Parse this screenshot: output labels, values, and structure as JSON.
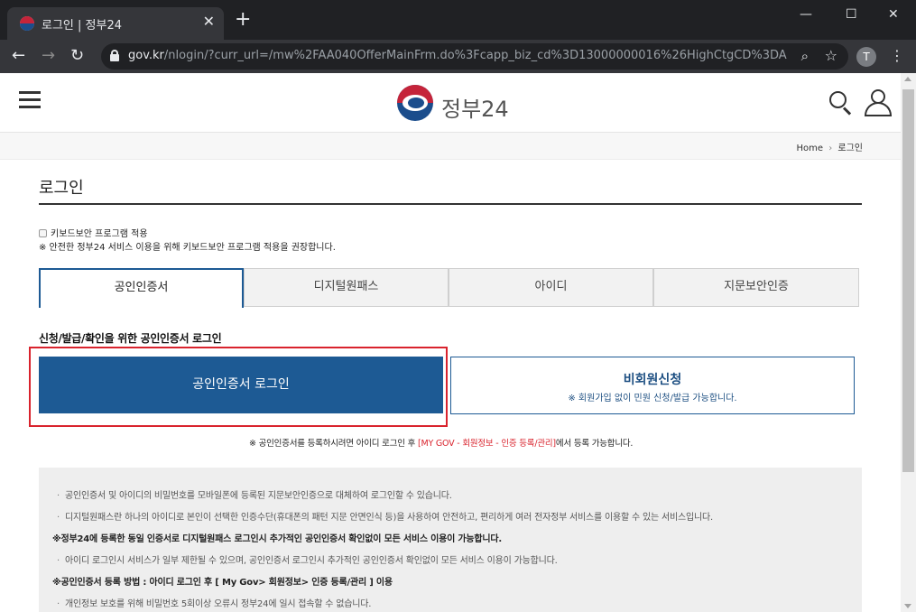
{
  "browser": {
    "tab_title": "로그인 | 정부24",
    "tab_close": "✕",
    "new_tab": "+",
    "url_host": "gov.kr",
    "url_path": "/nlogin/?curr_url=/mw%2FAA040OfferMainFrm.do%3Fcapp_biz_cd%3D13000000016%26HighCtgCD%3DA...",
    "profile_initial": "T",
    "window_controls": {
      "minimize": "—",
      "maximize": "☐",
      "close": "✕"
    },
    "nav": {
      "back": "←",
      "forward": "→",
      "reload": "↻"
    }
  },
  "header": {
    "logo_text": "정부24"
  },
  "breadcrumb": {
    "home": "Home",
    "separator": "›",
    "current": "로그인"
  },
  "page": {
    "title": "로그인",
    "keyboard_security_label": "키보드보안 프로그램 적용",
    "keyboard_security_note": "※ 안전한 정부24 서비스 이용을 위해 키보드보안 프로그램 적용을 권장합니다."
  },
  "tabs": [
    {
      "label": "공인인증서",
      "active": true
    },
    {
      "label": "디지털원패스",
      "active": false
    },
    {
      "label": "아이디",
      "active": false
    },
    {
      "label": "지문보안인증",
      "active": false
    }
  ],
  "cert_section": {
    "heading": "신청/발급/확인을 위한 공인인증서 로그인",
    "login_button": "공인인증서 로그인",
    "guest_title": "비회원신청",
    "guest_subtitle": "※ 회원가입 없이 민원 신청/발급 가능합니다."
  },
  "register_note": {
    "before": "※ 공인인증서를 등록하시려면 아이디 로그인 후 ",
    "link": "[MY GOV - 회원정보 - 인증 등록/관리]",
    "after": "에서 등록 가능합니다."
  },
  "info": [
    {
      "text": "공인인증서 및 아이디의 비밀번호를 모바일폰에 등록된 지문보안인증으로 대체하여 로그인할 수 있습니다.",
      "style": "bullet"
    },
    {
      "text": "디지털원패스란 하나의 아이디로 본인이 선택한 인증수단(휴대폰의 패턴 지문 안면인식 등)을 사용하여 안전하고, 편리하게 여러 전자정부 서비스를 이용할 수 있는 서비스입니다.",
      "style": "bullet"
    },
    {
      "text": "※정부24에 등록한 동일 인증서로 디지털원패스 로그인시 추가적인 공인인증서 확인없이 모든 서비스 이용이 가능합니다.",
      "style": "strong"
    },
    {
      "text": "아이디 로그인시 서비스가 일부 제한될 수 있으며, 공인인증서 로그인시 추가적인 공인인증서 확인없이 모든 서비스 이용이 가능합니다.",
      "style": "bullet"
    },
    {
      "text": "※공인인증서 등록 방법 : 아이디 로그인 후 [ My Gov> 회원정보> 인증 등록/관리 ] 이용",
      "style": "strong"
    },
    {
      "text": "개인정보 보호를 위해 비밀번호 5회이상 오류시 정부24에 일시 접속할 수 없습니다.",
      "style": "bullet"
    }
  ],
  "colors": {
    "primary_blue": "#1d5a94",
    "highlight_red": "#d9232d",
    "chrome_dark": "#202124"
  },
  "icons": [
    "hamburger-menu-icon",
    "search-icon",
    "user-icon",
    "lock-icon",
    "star-icon",
    "zoom-icon",
    "kebab-menu-icon"
  ]
}
